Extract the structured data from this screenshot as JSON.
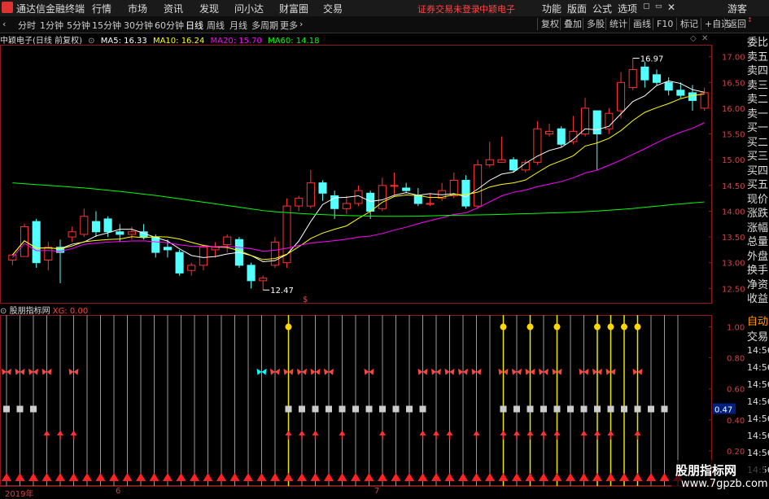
{
  "menu": {
    "app_title": "通达信金融终端",
    "items": [
      "行情",
      "市场",
      "资讯",
      "发现",
      "问小达",
      "财富圈",
      "交易"
    ],
    "status": "证券交易未登录",
    "stock": "中颖电子",
    "right": [
      "功能",
      "版面",
      "公式",
      "选项"
    ],
    "guest": "游客"
  },
  "periods": [
    "分时",
    "1分钟",
    "5分钟",
    "15分钟",
    "30分钟",
    "60分钟",
    "日线",
    "周线",
    "月线",
    "多周期",
    "更多"
  ],
  "active_period": "日线",
  "toolbar_right": [
    "复权",
    "叠加",
    "多股",
    "统计",
    "画线",
    "F10",
    "标记",
    "+自选",
    "返回"
  ],
  "main": {
    "title": "中颖电子(日线 前复权)",
    "ma5": "MA5: 16.33",
    "ma10": "MA10: 16.24",
    "ma20": "MA20: 15.70",
    "ma60": "MA60: 14.18",
    "high_label": "16.97",
    "low_label": "12.47",
    "y_ticks": [
      "17.00",
      "16.50",
      "16.00",
      "15.50",
      "15.00",
      "14.50",
      "14.00",
      "13.50",
      "13.00",
      "12.50"
    ],
    "colors": {
      "ma5": "#ffffff",
      "ma10": "#ffff00",
      "ma20": "#ff00ff",
      "ma60": "#00ff00",
      "up": "#ff3232",
      "down": "#54ffff"
    }
  },
  "right_panel": [
    "委比",
    "卖五",
    "卖四",
    "卖三",
    "卖二",
    "卖一",
    "买一",
    "买二",
    "买三",
    "买四",
    "买五",
    "现价",
    "涨跌",
    "涨幅",
    "总量",
    "外盘",
    "换手",
    "净资",
    "收益"
  ],
  "right_panel_lower": [
    "自动",
    "交易"
  ],
  "right_panel_times": [
    "14:56",
    "14:56",
    "14:56",
    "14:56",
    "14:56",
    "14:56",
    "14:56",
    "14:56"
  ],
  "indicator": {
    "name": "股朋指标网",
    "xg": "XG: 0.00",
    "y_ticks": [
      "1.00",
      "0.80",
      "0.60",
      "0.40",
      "0.20"
    ],
    "current": "0.47"
  },
  "x_axis": [
    "2019年",
    "6",
    "7"
  ],
  "watermark": {
    "line1": "股朋指标网",
    "line2": "www.7gpzb.com"
  },
  "chart_data": {
    "type": "candlestick",
    "candles": [
      [
        13.05,
        13.15,
        12.95,
        13.12
      ],
      [
        13.12,
        13.7,
        13.3,
        13.76
      ],
      [
        13.8,
        13.0,
        12.9,
        13.85
      ],
      [
        13.05,
        13.3,
        12.85,
        13.4
      ],
      [
        13.3,
        13.2,
        12.6,
        13.45
      ],
      [
        13.5,
        13.6,
        13.4,
        13.7
      ],
      [
        13.55,
        13.9,
        13.5,
        14.05
      ],
      [
        13.8,
        13.6,
        13.5,
        14.0
      ],
      [
        13.85,
        13.6,
        13.5,
        13.9
      ],
      [
        13.6,
        13.55,
        13.4,
        13.75
      ],
      [
        13.55,
        13.6,
        13.45,
        13.7
      ],
      [
        13.6,
        13.5,
        13.45,
        13.75
      ],
      [
        13.5,
        13.2,
        13.1,
        13.55
      ],
      [
        13.3,
        13.25,
        13.1,
        13.45
      ],
      [
        13.2,
        12.8,
        12.75,
        13.25
      ],
      [
        12.85,
        12.95,
        12.75,
        13.0
      ],
      [
        12.95,
        13.3,
        12.85,
        13.35
      ],
      [
        13.25,
        13.3,
        13.1,
        13.4
      ],
      [
        13.35,
        13.5,
        13.2,
        13.55
      ],
      [
        13.45,
        12.95,
        12.9,
        13.5
      ],
      [
        12.95,
        12.65,
        12.5,
        13.0
      ],
      [
        12.65,
        12.7,
        12.47,
        12.75
      ],
      [
        12.95,
        13.4,
        12.9,
        13.5
      ],
      [
        13.0,
        14.1,
        12.9,
        14.25
      ],
      [
        14.1,
        14.25,
        14.0,
        14.3
      ],
      [
        14.1,
        14.55,
        14.05,
        14.8
      ],
      [
        14.55,
        14.35,
        14.2,
        14.6
      ],
      [
        14.3,
        14.05,
        13.85,
        14.4
      ],
      [
        14.05,
        14.15,
        13.95,
        14.3
      ],
      [
        14.15,
        14.4,
        14.1,
        14.5
      ],
      [
        14.35,
        14.0,
        13.85,
        14.4
      ],
      [
        14.05,
        14.5,
        14.0,
        14.65
      ],
      [
        14.5,
        14.5,
        14.3,
        14.75
      ],
      [
        14.45,
        14.4,
        14.35,
        14.55
      ],
      [
        14.3,
        14.15,
        14.1,
        14.45
      ],
      [
        14.15,
        14.15,
        14.1,
        14.35
      ],
      [
        14.25,
        14.4,
        14.2,
        14.55
      ],
      [
        14.3,
        14.6,
        14.25,
        14.75
      ],
      [
        14.6,
        14.1,
        14.05,
        14.7
      ],
      [
        14.1,
        14.9,
        14.05,
        15.0
      ],
      [
        14.9,
        15.0,
        14.85,
        15.35
      ],
      [
        14.95,
        15.0,
        14.95,
        15.45
      ],
      [
        15.0,
        14.8,
        14.75,
        15.05
      ],
      [
        14.8,
        14.95,
        14.75,
        15.0
      ],
      [
        14.95,
        15.6,
        14.9,
        15.75
      ],
      [
        15.5,
        15.55,
        15.45,
        15.7
      ],
      [
        15.6,
        15.3,
        15.25,
        15.65
      ],
      [
        15.35,
        15.55,
        15.3,
        15.85
      ],
      [
        15.5,
        16.0,
        15.45,
        16.2
      ],
      [
        15.95,
        15.5,
        14.8,
        15.95
      ],
      [
        15.6,
        15.9,
        15.5,
        16.0
      ],
      [
        15.95,
        16.5,
        15.8,
        16.7
      ],
      [
        16.4,
        16.75,
        16.35,
        16.97
      ],
      [
        16.8,
        16.55,
        16.4,
        16.9
      ],
      [
        16.65,
        16.5,
        16.45,
        16.75
      ],
      [
        16.5,
        16.35,
        16.25,
        16.6
      ],
      [
        16.35,
        16.25,
        16.2,
        16.5
      ],
      [
        16.3,
        16.15,
        15.95,
        16.45
      ],
      [
        16.0,
        16.3,
        15.95,
        16.4
      ]
    ]
  }
}
